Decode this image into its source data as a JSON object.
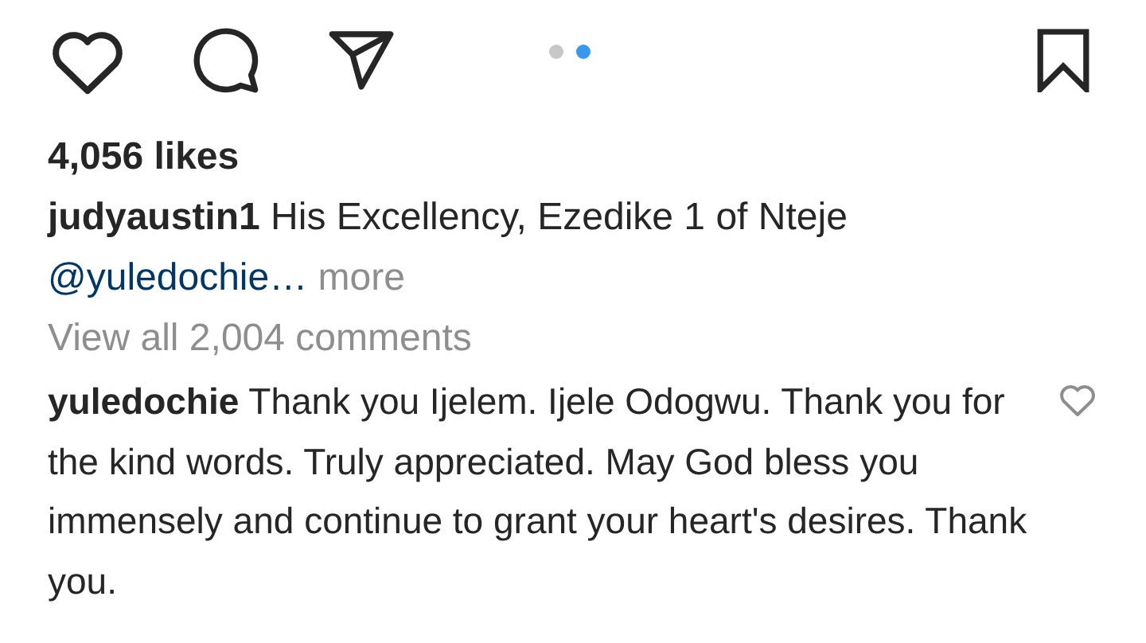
{
  "carousel_dots": [
    {
      "selected": false
    },
    {
      "selected": true
    }
  ],
  "likes": "4,056 likes",
  "caption": {
    "username": "judyaustin1",
    "text": "His Excellency, Ezedike 1 of Nteje",
    "mention": "@yuledochie…",
    "more": "more"
  },
  "view_comments": "View all 2,004 comments",
  "comment": {
    "username": "yuledochie",
    "text": "Thank you Ijelem. Ijele Odogwu. Thank you for the kind words. Truly appreciated. May God bless you immensely and continue to grant your heart's desires. Thank you.",
    "liked": false
  }
}
